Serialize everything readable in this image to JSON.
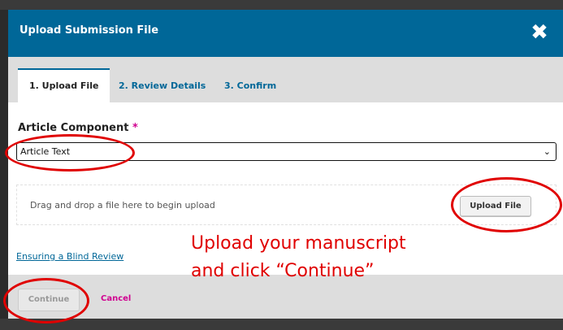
{
  "modal": {
    "title": "Upload Submission File",
    "close_icon": "close-icon"
  },
  "tabs": [
    {
      "label": "1. Upload File",
      "active": true
    },
    {
      "label": "2. Review Details",
      "active": false
    },
    {
      "label": "3. Confirm",
      "active": false
    }
  ],
  "form": {
    "field_label": "Article Component",
    "required_marker": "*",
    "selected_value": "Article Text",
    "drop_text": "Drag and drop a file here to begin upload",
    "upload_button": "Upload File",
    "blind_review_link": "Ensuring a Blind Review"
  },
  "footer": {
    "continue_label": "Continue",
    "cancel_label": "Cancel"
  },
  "annotation": {
    "line1": "Upload your manuscript",
    "line2": "and click “Continue”"
  },
  "colors": {
    "header": "#006798",
    "accent_pink": "#d00090",
    "annotation_red": "#e00000"
  }
}
